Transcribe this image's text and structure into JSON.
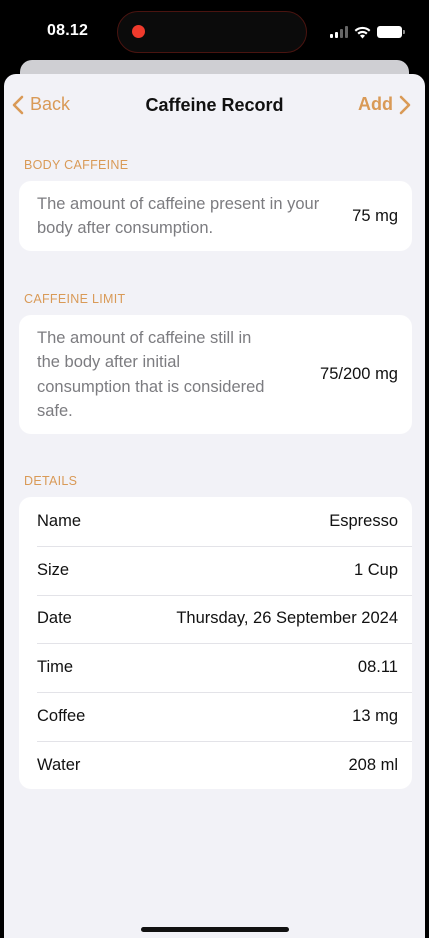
{
  "status_bar": {
    "time": "08.12"
  },
  "nav": {
    "back_label": "Back",
    "title": "Caffeine Record",
    "add_label": "Add"
  },
  "body_caffeine": {
    "header": "BODY CAFFEINE",
    "description": "The amount of caffeine present in your body after consumption.",
    "value": "75 mg"
  },
  "caffeine_limit": {
    "header": "CAFFEINE LIMIT",
    "description": "The amount of caffeine still in the body after initial consumption that is considered safe.",
    "value": "75/200 mg"
  },
  "details": {
    "header": "DETAILS",
    "rows": [
      {
        "label": "Name",
        "value": "Espresso"
      },
      {
        "label": "Size",
        "value": "1 Cup"
      },
      {
        "label": "Date",
        "value": "Thursday, 26 September 2024"
      },
      {
        "label": "Time",
        "value": "08.11"
      },
      {
        "label": "Coffee",
        "value": "13 mg"
      },
      {
        "label": "Water",
        "value": "208 ml"
      }
    ]
  },
  "colors": {
    "accent": "#d99a57",
    "background": "#f2f2f7",
    "recording": "#ef3a2c"
  }
}
